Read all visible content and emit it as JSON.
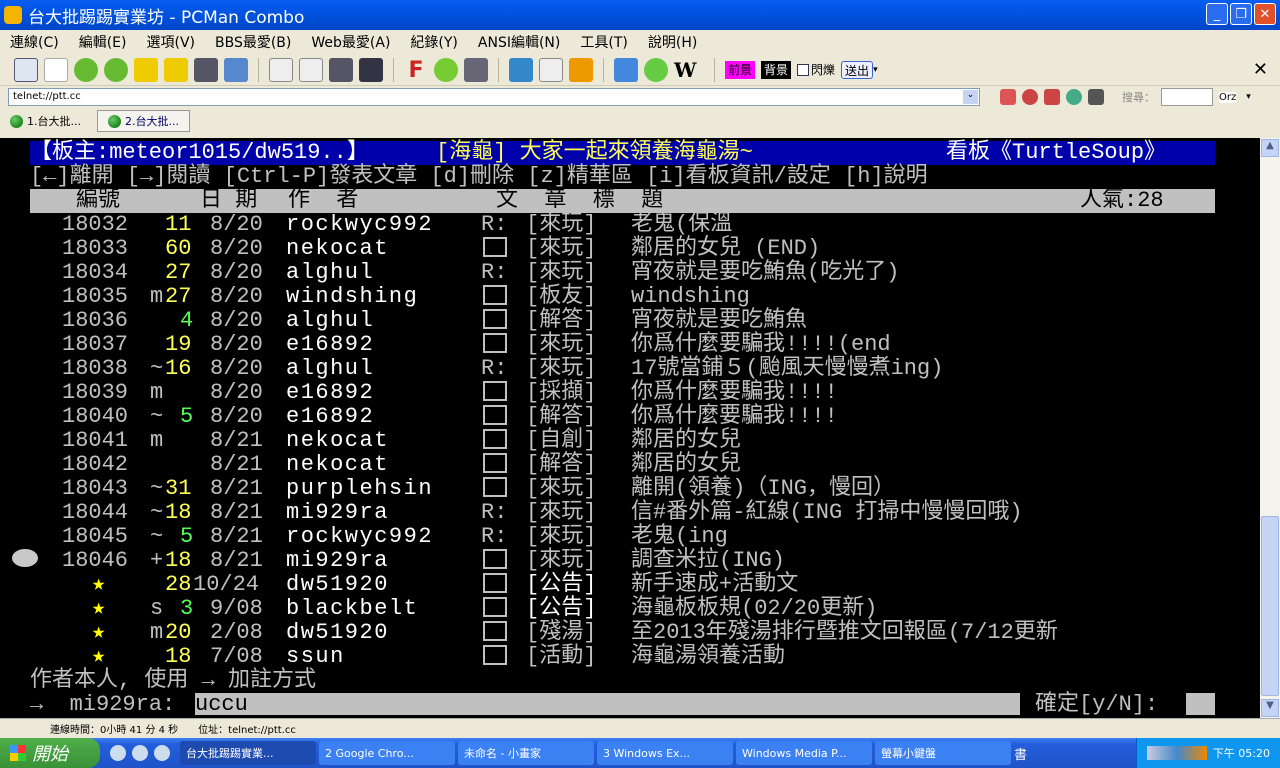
{
  "window": {
    "title": "台大批踢踢實業坊 - PCMan Combo"
  },
  "menu": [
    "連線(C)",
    "編輯(E)",
    "選項(V)",
    "BBS最愛(B)",
    "Web最愛(A)",
    "紀錄(Y)",
    "ANSI編輯(N)",
    "工具(T)",
    "說明(H)"
  ],
  "toolbar": {
    "fg_label": "前景",
    "bg_label": "背景",
    "blink_label": "閃爍",
    "send_label": "送出",
    "search_label": "搜尋：",
    "search_engine": "Orz"
  },
  "address": {
    "value": "telnet://ptt.cc"
  },
  "tabs": [
    {
      "label": "1.台大批..."
    },
    {
      "label": "2.台大批..."
    }
  ],
  "terminal": {
    "header": {
      "moderator": "【板主:meteor1015/dw519..】",
      "title": "[海龜] 大家一起來領養海龜湯~",
      "board": "看板《TurtleSoup》"
    },
    "help": "[←]離開 [→]閱讀 [Ctrl-P]發表文章 [d]刪除 [z]精華區 [i]看板資訊/設定 [h]說明",
    "columns": {
      "num": "編號",
      "date": "日 期",
      "author": "作  者",
      "title": "文  章  標  題",
      "popularity": "人氣:28"
    },
    "rows": [
      {
        "num": "18032",
        "mark": "",
        "push": "11",
        "pc": "y",
        "date": "8/20",
        "author": "rockwyc992",
        "type": "R:",
        "cat": "[來玩]",
        "title": "老鬼(保溫"
      },
      {
        "num": "18033",
        "mark": "",
        "push": "60",
        "pc": "y",
        "date": "8/20",
        "author": "nekocat",
        "type": "box",
        "cat": "[來玩]",
        "title": "鄰居的女兒 (END)"
      },
      {
        "num": "18034",
        "mark": "",
        "push": "27",
        "pc": "y",
        "date": "8/20",
        "author": "alghul",
        "type": "R:",
        "cat": "[來玩]",
        "title": "宵夜就是要吃鮪魚(吃光了)"
      },
      {
        "num": "18035",
        "mark": "m",
        "push": "27",
        "pc": "y",
        "date": "8/20",
        "author": "windshing",
        "type": "box",
        "cat": "[板友]",
        "title": "windshing"
      },
      {
        "num": "18036",
        "mark": "",
        "push": "4",
        "pc": "g",
        "date": "8/20",
        "author": "alghul",
        "type": "box",
        "cat": "[解答]",
        "title": "宵夜就是要吃鮪魚"
      },
      {
        "num": "18037",
        "mark": "",
        "push": "19",
        "pc": "y",
        "date": "8/20",
        "author": "e16892",
        "type": "box",
        "cat": "[來玩]",
        "title": "你爲什麼要騙我!!!!(end"
      },
      {
        "num": "18038",
        "mark": "~",
        "push": "16",
        "pc": "y",
        "date": "8/20",
        "author": "alghul",
        "type": "R:",
        "cat": "[來玩]",
        "title": "17號當鋪５(颱風天慢慢煮ing)"
      },
      {
        "num": "18039",
        "mark": "m",
        "push": "",
        "pc": "y",
        "date": "8/20",
        "author": "e16892",
        "type": "box",
        "cat": "[採擷]",
        "title": "你爲什麼要騙我!!!!"
      },
      {
        "num": "18040",
        "mark": "~",
        "push": "5",
        "pc": "g",
        "date": "8/20",
        "author": "e16892",
        "type": "box",
        "cat": "[解答]",
        "title": "你爲什麼要騙我!!!!"
      },
      {
        "num": "18041",
        "mark": "m",
        "push": "",
        "pc": "y",
        "date": "8/21",
        "author": "nekocat",
        "type": "box",
        "cat": "[自創]",
        "title": "鄰居的女兒"
      },
      {
        "num": "18042",
        "mark": "",
        "push": "",
        "pc": "y",
        "date": "8/21",
        "author": "nekocat",
        "type": "box",
        "cat": "[解答]",
        "title": "鄰居的女兒"
      },
      {
        "num": "18043",
        "mark": "~",
        "push": "31",
        "pc": "y",
        "date": "8/21",
        "author": "purplehsin",
        "type": "box",
        "cat": "[來玩]",
        "title": "離開(領養)（ING，慢回）"
      },
      {
        "num": "18044",
        "mark": "~",
        "push": "18",
        "pc": "y",
        "date": "8/21",
        "author": "mi929ra",
        "type": "R:",
        "cat": "[來玩]",
        "title": "信#番外篇-紅線(ING 打掃中慢慢回哦)"
      },
      {
        "num": "18045",
        "mark": "~",
        "push": "5",
        "pc": "g",
        "date": "8/21",
        "author": "rockwyc992",
        "type": "R:",
        "cat": "[來玩]",
        "title": "老鬼(ing"
      },
      {
        "num": "18046",
        "mark": "+",
        "push": "18",
        "pc": "y",
        "date": "8/21",
        "author": "mi929ra",
        "type": "box",
        "cat": "[來玩]",
        "title": "調查米拉(ING)",
        "cursor": true
      },
      {
        "num": "★",
        "mark": "",
        "push": "28",
        "pc": "y",
        "date": "10/24",
        "author": "dw51920",
        "type": "box",
        "cat": "[公告]",
        "title": "新手速成+活動文",
        "star": true
      },
      {
        "num": "★",
        "mark": "s",
        "push": "3",
        "pc": "g",
        "date": "9/08",
        "author": "blackbelt",
        "type": "box",
        "cat": "[公告]",
        "title": "海龜板板規(02/20更新)",
        "star": true
      },
      {
        "num": "★",
        "mark": "m",
        "push": "20",
        "pc": "y",
        "date": "2/08",
        "author": "dw51920",
        "type": "box",
        "cat": "[殘湯]",
        "title": "至2013年殘湯排行暨推文回報區(7/12更新",
        "star": true
      },
      {
        "num": "★",
        "mark": "",
        "push": "18",
        "pc": "y",
        "date": "7/08",
        "author": "ssun",
        "type": "box",
        "cat": "[活動]",
        "title": "海龜湯領養活動",
        "star": true
      }
    ],
    "prompt": "作者本人, 使用 → 加註方式",
    "input_prefix": "→  mi929ra:",
    "input_value": "uccu",
    "confirm": "確定[y/N]:"
  },
  "status": {
    "conn_time": "連線時間：0小時 41 分 4 秒",
    "address": "位址：telnet://ptt.cc"
  },
  "taskbar": {
    "start": "開始",
    "tasks": [
      "台大批踢踢實業...",
      "2 Google Chro...",
      "未命名 - 小畫家",
      "3 Windows Ex...",
      "Windows Media P...",
      "螢幕小鍵盤"
    ],
    "ime": "書",
    "clock": "下午 05:20"
  }
}
